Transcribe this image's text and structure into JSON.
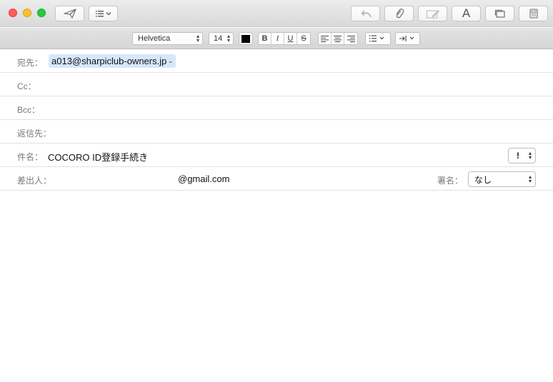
{
  "toolbar": {
    "icons": [
      "send-icon",
      "header-fields-icon",
      "reply-icon",
      "attach-icon",
      "markup-icon",
      "font-icon",
      "window-icon",
      "browser-icon"
    ],
    "font_button_label": "A"
  },
  "format_bar": {
    "font_family": "Helvetica",
    "font_size": "14",
    "text_color": "#000000",
    "bold_label": "B",
    "italic_label": "I",
    "underline_label": "U",
    "strike_label": "S"
  },
  "fields": {
    "to_label": "宛先：",
    "to_value": "a013@sharpiclub-owners.jp",
    "cc_label": "Cc：",
    "bcc_label": "Bcc：",
    "reply_to_label": "返信先：",
    "subject_label": "件名：",
    "subject_value": "COCORO ID登録手続き",
    "priority_value": "!",
    "from_label": "差出人：",
    "from_value": "@gmail.com",
    "signature_label": "署名：",
    "signature_value": "なし"
  }
}
